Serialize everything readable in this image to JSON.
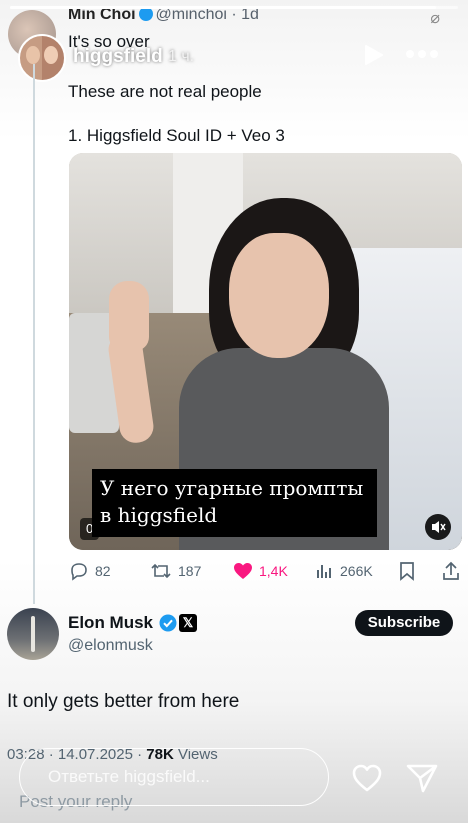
{
  "story": {
    "username": "higgsfield",
    "time": "1 ч.",
    "progress": 0.95,
    "reply_placeholder": "Ответьте higgsfield..."
  },
  "tweet": {
    "author_name": "Min Choi",
    "author_handle": "@minchoi",
    "time_ago": "1d",
    "lines": [
      "It's so over",
      "These are not real people",
      "1. Higgsfield Soul ID + Veo 3"
    ],
    "video_caption": "У него угарные промпты в higgsfield",
    "video_time": "0",
    "stats": {
      "replies": "82",
      "retweets": "187",
      "likes": "1,4K",
      "views": "266K"
    }
  },
  "reply": {
    "name": "Elon Musk",
    "handle": "@elonmusk",
    "subscribe_label": "Subscribe",
    "text": "It only gets better from here",
    "timestamp": "03:28 · 14.07.2025 ·",
    "views_count": "78K",
    "views_label": "Views",
    "post_reply_placeholder": "Post your reply"
  },
  "colors": {
    "like": "#f91880",
    "verified": "#1d9bf0",
    "text": "#0f1419",
    "secondary": "#536471"
  }
}
